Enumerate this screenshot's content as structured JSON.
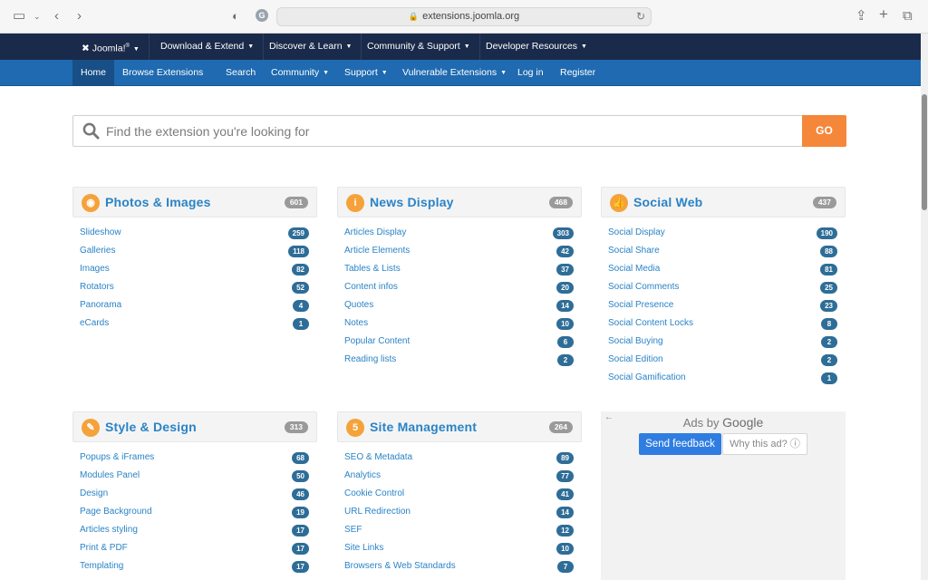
{
  "browser": {
    "url": "extensions.joomla.org"
  },
  "topnav": {
    "brand": "Joomla!",
    "items": [
      "Download & Extend",
      "Discover & Learn",
      "Community & Support",
      "Developer Resources"
    ]
  },
  "subnav": {
    "items": [
      "Home",
      "Browse Extensions",
      "Search",
      "Community",
      "Support",
      "Vulnerable Extensions",
      "Log in",
      "Register"
    ]
  },
  "search": {
    "placeholder": "Find the extension you're looking for",
    "go_label": "GO"
  },
  "categories": [
    {
      "title": "Photos & Images",
      "count": "601",
      "items": [
        {
          "label": "Slideshow",
          "count": "259"
        },
        {
          "label": "Galleries",
          "count": "118"
        },
        {
          "label": "Images",
          "count": "82"
        },
        {
          "label": "Rotators",
          "count": "52"
        },
        {
          "label": "Panorama",
          "count": "4"
        },
        {
          "label": "eCards",
          "count": "1"
        }
      ]
    },
    {
      "title": "News Display",
      "count": "468",
      "items": [
        {
          "label": "Articles Display",
          "count": "303"
        },
        {
          "label": "Article Elements",
          "count": "42"
        },
        {
          "label": "Tables & Lists",
          "count": "37"
        },
        {
          "label": "Content infos",
          "count": "20"
        },
        {
          "label": "Quotes",
          "count": "14"
        },
        {
          "label": "Notes",
          "count": "10"
        },
        {
          "label": "Popular Content",
          "count": "6"
        },
        {
          "label": "Reading lists",
          "count": "2"
        }
      ]
    },
    {
      "title": "Social Web",
      "count": "437",
      "items": [
        {
          "label": "Social Display",
          "count": "190"
        },
        {
          "label": "Social Share",
          "count": "88"
        },
        {
          "label": "Social Media",
          "count": "81"
        },
        {
          "label": "Social Comments",
          "count": "25"
        },
        {
          "label": "Social Presence",
          "count": "23"
        },
        {
          "label": "Social Content Locks",
          "count": "8"
        },
        {
          "label": "Social Buying",
          "count": "2"
        },
        {
          "label": "Social Edition",
          "count": "2"
        },
        {
          "label": "Social Gamification",
          "count": "1"
        }
      ]
    },
    {
      "title": "Style & Design",
      "count": "313",
      "items": [
        {
          "label": "Popups & iFrames",
          "count": "68"
        },
        {
          "label": "Modules Panel",
          "count": "50"
        },
        {
          "label": "Design",
          "count": "46"
        },
        {
          "label": "Page Background",
          "count": "19"
        },
        {
          "label": "Articles styling",
          "count": "17"
        },
        {
          "label": "Print & PDF",
          "count": "17"
        },
        {
          "label": "Templating",
          "count": "17"
        }
      ]
    },
    {
      "title": "Site Management",
      "count": "264",
      "items": [
        {
          "label": "SEO & Metadata",
          "count": "89"
        },
        {
          "label": "Analytics",
          "count": "77"
        },
        {
          "label": "Cookie Control",
          "count": "41"
        },
        {
          "label": "URL Redirection",
          "count": "14"
        },
        {
          "label": "SEF",
          "count": "12"
        },
        {
          "label": "Site Links",
          "count": "10"
        },
        {
          "label": "Browsers & Web Standards",
          "count": "7"
        }
      ]
    }
  ],
  "ads": {
    "ads_by": "Ads by",
    "google": "Google",
    "send_feedback": "Send feedback",
    "why_this_ad": "Why this ad?"
  },
  "colors": {
    "topnav_bg": "#1a2a4a",
    "subnav_bg": "#1f6ab0",
    "go_button": "#f5873a",
    "category_icon": "#f5a23a",
    "link": "#2a83c6"
  }
}
